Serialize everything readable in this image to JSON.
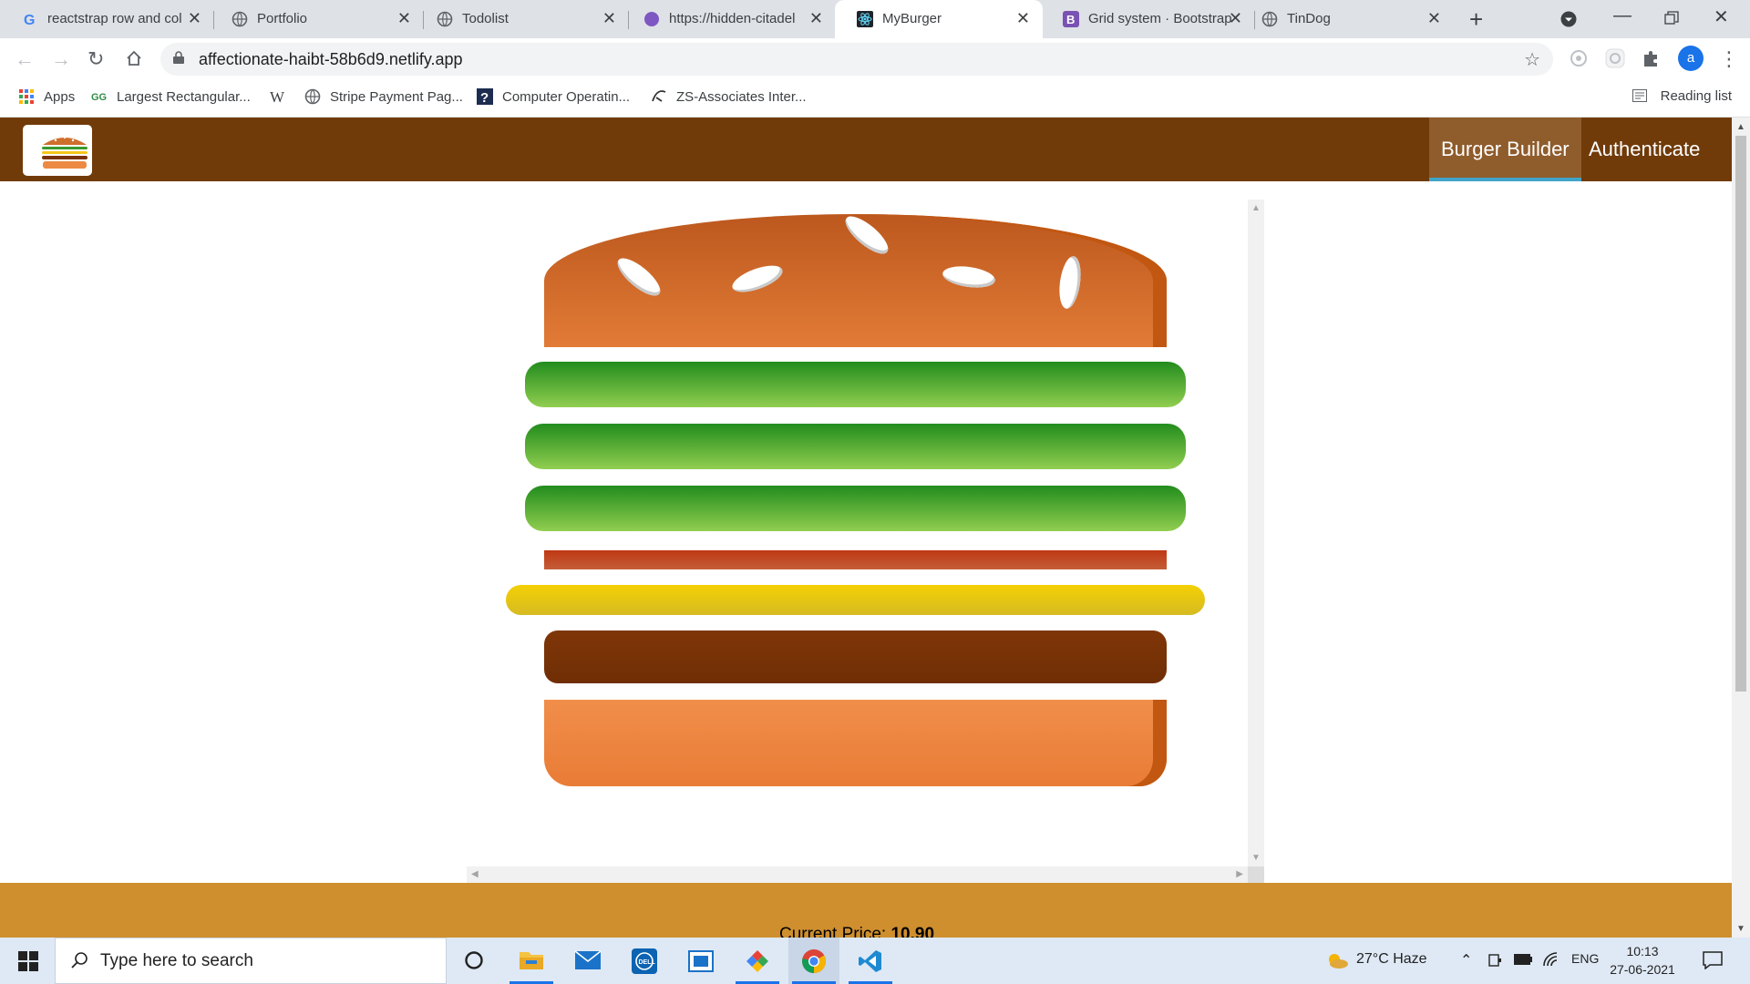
{
  "browser": {
    "tabs": [
      {
        "title": "reactstrap row and col",
        "icon": "google-icon"
      },
      {
        "title": "Portfolio",
        "icon": "globe-icon"
      },
      {
        "title": "Todolist",
        "icon": "globe-icon"
      },
      {
        "title": "https://hidden-citadel",
        "icon": "purple-circle-icon"
      },
      {
        "title": "MyBurger",
        "icon": "react-icon",
        "active": true
      },
      {
        "title": "Grid system · Bootstrap",
        "icon": "bootstrap-icon"
      },
      {
        "title": "TinDog",
        "icon": "globe-icon"
      }
    ],
    "url": "affectionate-haibt-58b6d9.netlify.app",
    "avatar_letter": "a",
    "bookmarks": [
      {
        "label": "Apps",
        "icon": "apps-grid-icon"
      },
      {
        "label": "Largest Rectangular...",
        "icon": "gfg-icon"
      },
      {
        "label": "W",
        "icon": "wikipedia-icon"
      },
      {
        "label": "Stripe Payment Pag...",
        "icon": "globe-icon"
      },
      {
        "label": "Computer Operatin...",
        "icon": "question-icon"
      },
      {
        "label": "ZS-Associates Inter...",
        "icon": "zs-icon"
      }
    ],
    "reading_list": "Reading list"
  },
  "app": {
    "nav": {
      "burger_builder": "Burger Builder",
      "authenticate": "Authenticate"
    },
    "ingredients": [
      "bread-top",
      "salad",
      "salad",
      "salad",
      "bacon",
      "cheese",
      "meat",
      "bread-bottom"
    ],
    "price_label": "Current Price:",
    "price_value": "10.90",
    "colors": {
      "header": "#703b09",
      "active_nav": "#8f5c2c",
      "controls": "#cf8f2e"
    }
  },
  "taskbar": {
    "search_placeholder": "Type here to search",
    "apps": [
      "cortana-icon",
      "file-explorer-icon",
      "mail-icon",
      "dell-icon",
      "store-icon",
      "app-icon",
      "chrome-icon",
      "vscode-icon"
    ],
    "weather": "27°C  Haze",
    "language": "ENG",
    "time": "10:13",
    "date": "27-06-2021"
  }
}
